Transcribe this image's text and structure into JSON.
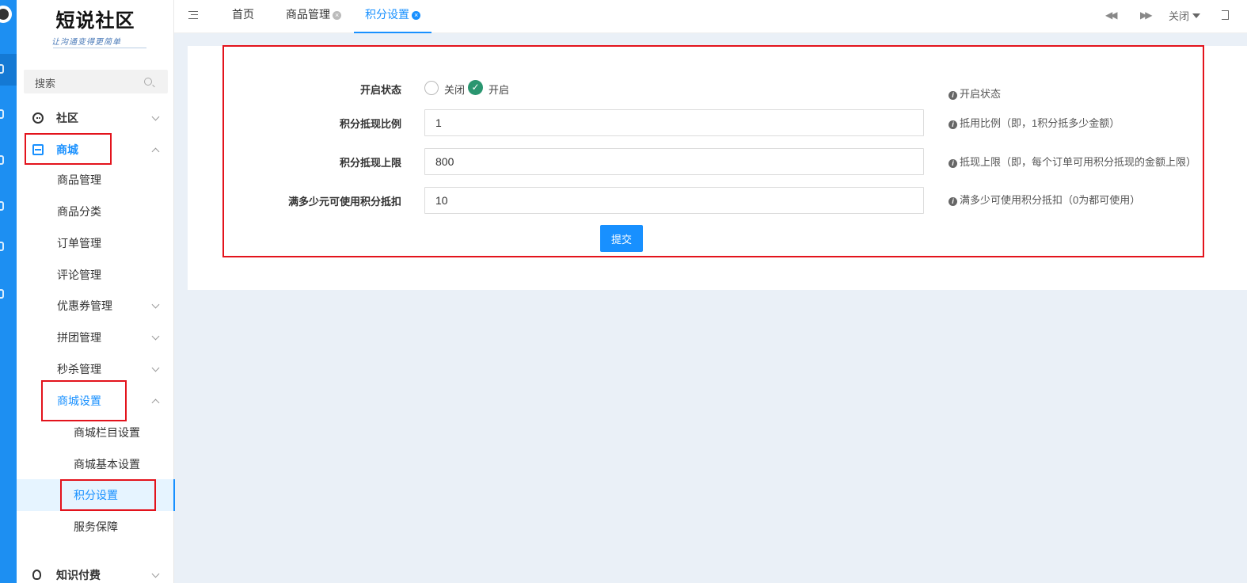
{
  "sidebar": {
    "logo_title": "短说社区",
    "logo_subtitle": "让沟通变得更简单",
    "search_placeholder": "搜索",
    "items": [
      {
        "label": "社区"
      },
      {
        "label": "商城"
      },
      {
        "label": "商品管理"
      },
      {
        "label": "商品分类"
      },
      {
        "label": "订单管理"
      },
      {
        "label": "评论管理"
      },
      {
        "label": "优惠券管理"
      },
      {
        "label": "拼团管理"
      },
      {
        "label": "秒杀管理"
      },
      {
        "label": "商城设置"
      },
      {
        "label": "商城栏目设置"
      },
      {
        "label": "商城基本设置"
      },
      {
        "label": "积分设置"
      },
      {
        "label": "服务保障"
      },
      {
        "label": "知识付费"
      }
    ]
  },
  "topbar": {
    "tabs": [
      {
        "label": "首页"
      },
      {
        "label": "商品管理"
      },
      {
        "label": "积分设置"
      }
    ],
    "close_label": "关闭"
  },
  "form": {
    "status": {
      "label": "开启状态",
      "option_off": "关闭",
      "option_on": "开启",
      "selected": "开启",
      "hint": "开启状态"
    },
    "ratio": {
      "label": "积分抵现比例",
      "value": "1",
      "hint": "抵用比例（即，1积分抵多少金额）"
    },
    "limit": {
      "label": "积分抵现上限",
      "value": "800",
      "hint": "抵现上限（即，每个订单可用积分抵现的金额上限）"
    },
    "threshold": {
      "label": "满多少元可使用积分抵扣",
      "value": "10",
      "hint": "满多少可使用积分抵扣（0为都可使用）"
    },
    "submit_label": "提交"
  },
  "colors": {
    "accent": "#1890ff",
    "rail": "#1d8ff2",
    "highlight_box": "#e3131c",
    "radio_checked": "#2a9670"
  }
}
